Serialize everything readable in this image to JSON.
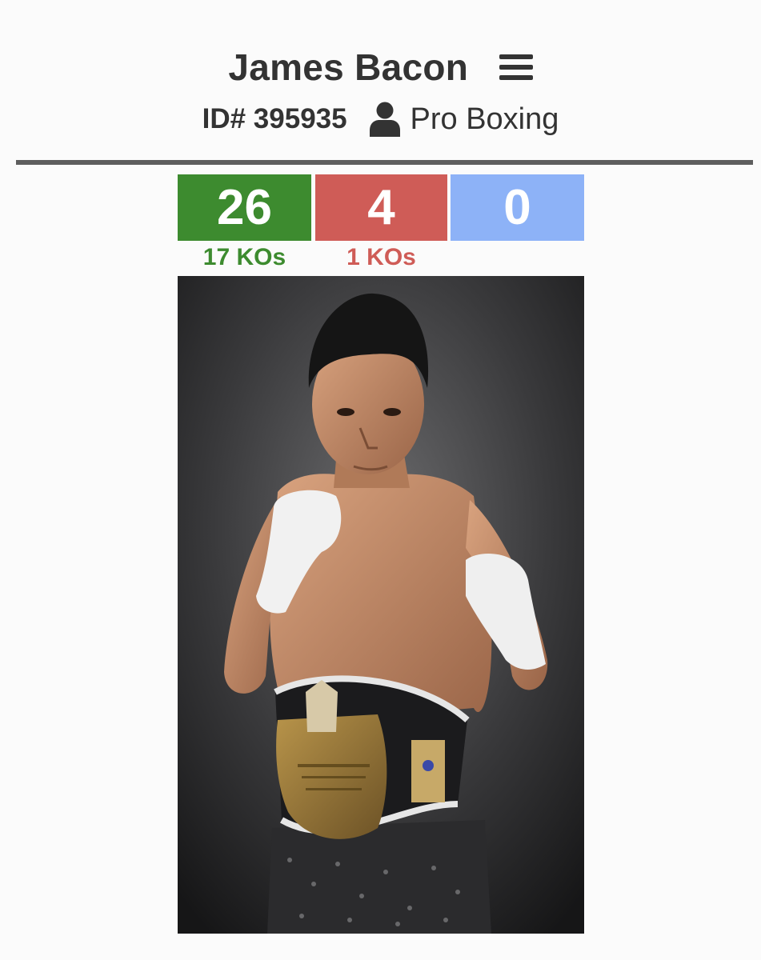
{
  "header": {
    "name": "James Bacon",
    "id_label": "ID# 395935",
    "sport": "Pro Boxing",
    "menu_icon": "hamburger-menu-icon",
    "user_icon": "person-icon"
  },
  "record": {
    "wins": "26",
    "losses": "4",
    "draws": "0",
    "wins_kos": "17 KOs",
    "losses_kos": "1 KOs"
  },
  "colors": {
    "win": "#3d8b2f",
    "loss": "#cf5c57",
    "draw": "#8db2f7",
    "text": "#333333",
    "divider": "#5e5e5e"
  },
  "photo": {
    "subject": "boxer-with-championship-belt"
  }
}
